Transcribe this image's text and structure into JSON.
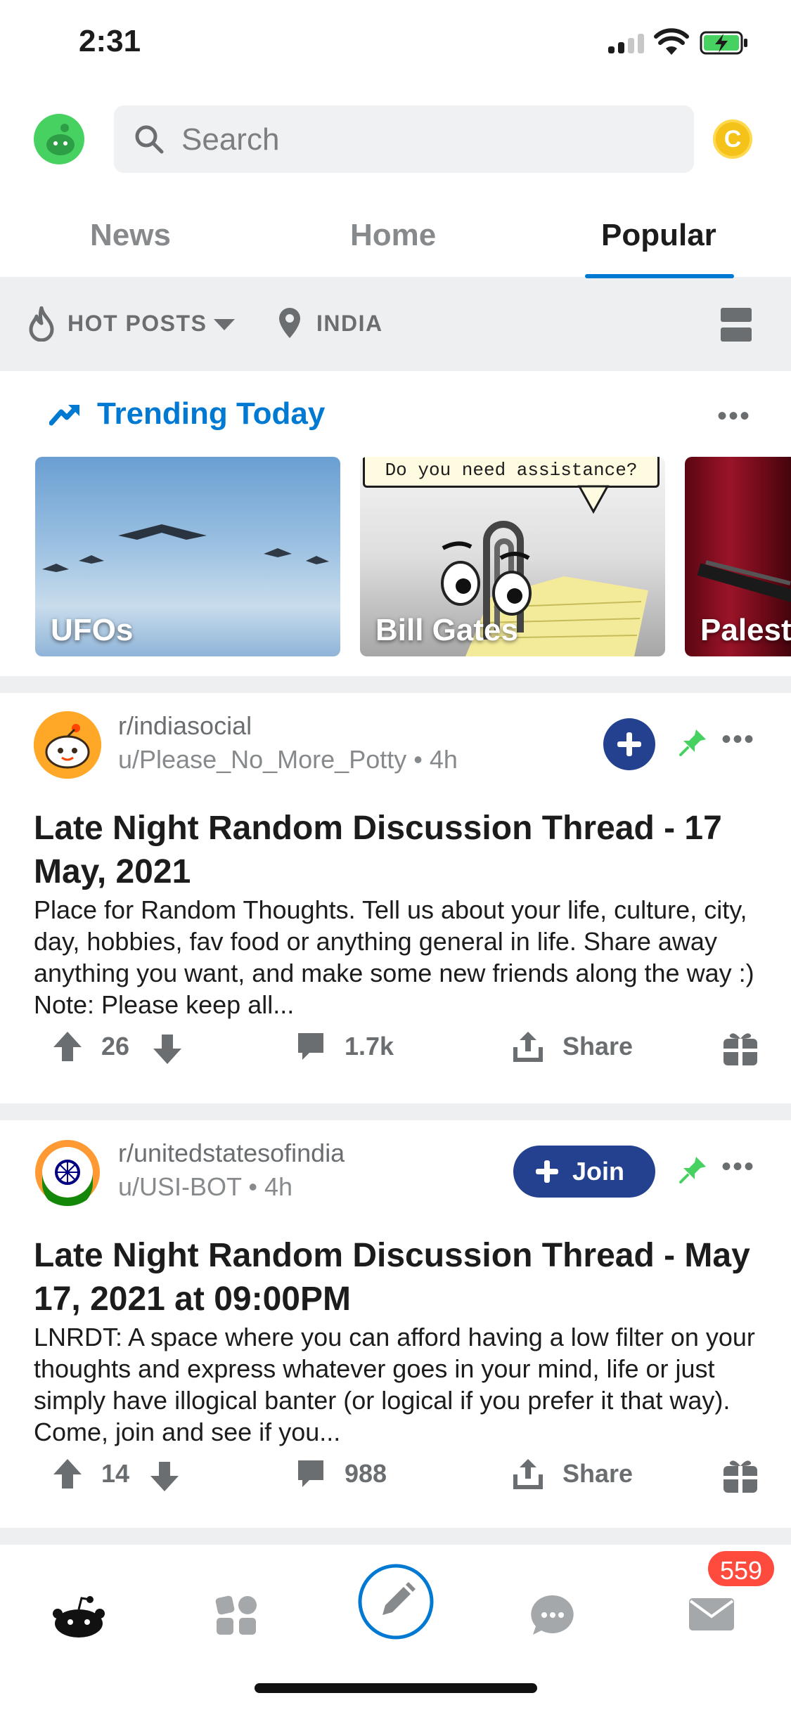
{
  "status_bar": {
    "time": "2:31"
  },
  "header": {
    "search_placeholder": "Search",
    "coin_label": "C"
  },
  "tabs": [
    {
      "label": "News"
    },
    {
      "label": "Home"
    },
    {
      "label": "Popular",
      "active": true
    }
  ],
  "filters": {
    "sort_label": "HOT POSTS",
    "location_label": "INDIA"
  },
  "trending": {
    "title": "Trending Today",
    "cards": [
      {
        "label": "UFOs"
      },
      {
        "label": "Bill Gates",
        "speech_bubble": "Do you need assistance?"
      },
      {
        "label": "Palest"
      }
    ]
  },
  "posts": [
    {
      "subreddit": "r/indiasocial",
      "author": "u/Please_No_More_Potty",
      "time": "4h",
      "title": "Late Night Random Discussion Thread - 17 May, 2021",
      "body": "Place for Random Thoughts. Tell us about your life, culture, city, day, hobbies, fav food or anything general in life. Share away anything you want, and make some new friends along the way :) Note: Please keep all...",
      "votes": "26",
      "comments": "1.7k",
      "share_label": "Share"
    },
    {
      "subreddit": "r/unitedstatesofindia",
      "author": "u/USI-BOT",
      "time": "4h",
      "join_label": "Join",
      "title": "Late Night Random Discussion Thread - May 17, 2021 at 09:00PM",
      "body": "LNRDT: A space where you can afford having a low filter on your thoughts and express whatever goes in your mind, life or just simply have illogical banter (or logical if you prefer it that way). Come, join and see if you...",
      "votes": "14",
      "comments": "988",
      "share_label": "Share"
    }
  ],
  "bottom_nav": {
    "inbox_badge": "559"
  },
  "colors": {
    "accent": "#0079d3",
    "join": "#24418f",
    "pin": "#46d160",
    "badge": "#ff4b3e"
  }
}
